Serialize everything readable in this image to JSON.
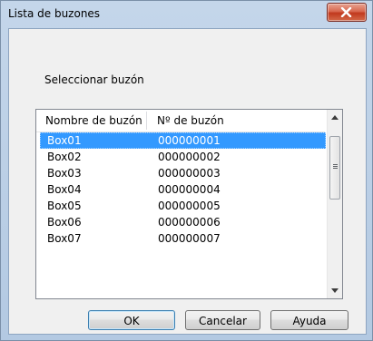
{
  "window": {
    "title": "Lista de buzones"
  },
  "dialog": {
    "prompt": "Seleccionar buzón",
    "columns": [
      "Nombre de buzón",
      "Nº de buzón"
    ],
    "rows": [
      {
        "name": "Box01",
        "number": "000000001",
        "selected": true
      },
      {
        "name": "Box02",
        "number": "000000002"
      },
      {
        "name": "Box03",
        "number": "000000003"
      },
      {
        "name": "Box04",
        "number": "000000004"
      },
      {
        "name": "Box05",
        "number": "000000005"
      },
      {
        "name": "Box06",
        "number": "000000006"
      },
      {
        "name": "Box07",
        "number": "000000007"
      }
    ],
    "buttons": {
      "ok": "OK",
      "cancel": "Cancelar",
      "help": "Ayuda"
    }
  },
  "colors": {
    "selection": "#3399ff",
    "close_button": "#c1381d"
  },
  "icons": {
    "close": "close-icon"
  }
}
